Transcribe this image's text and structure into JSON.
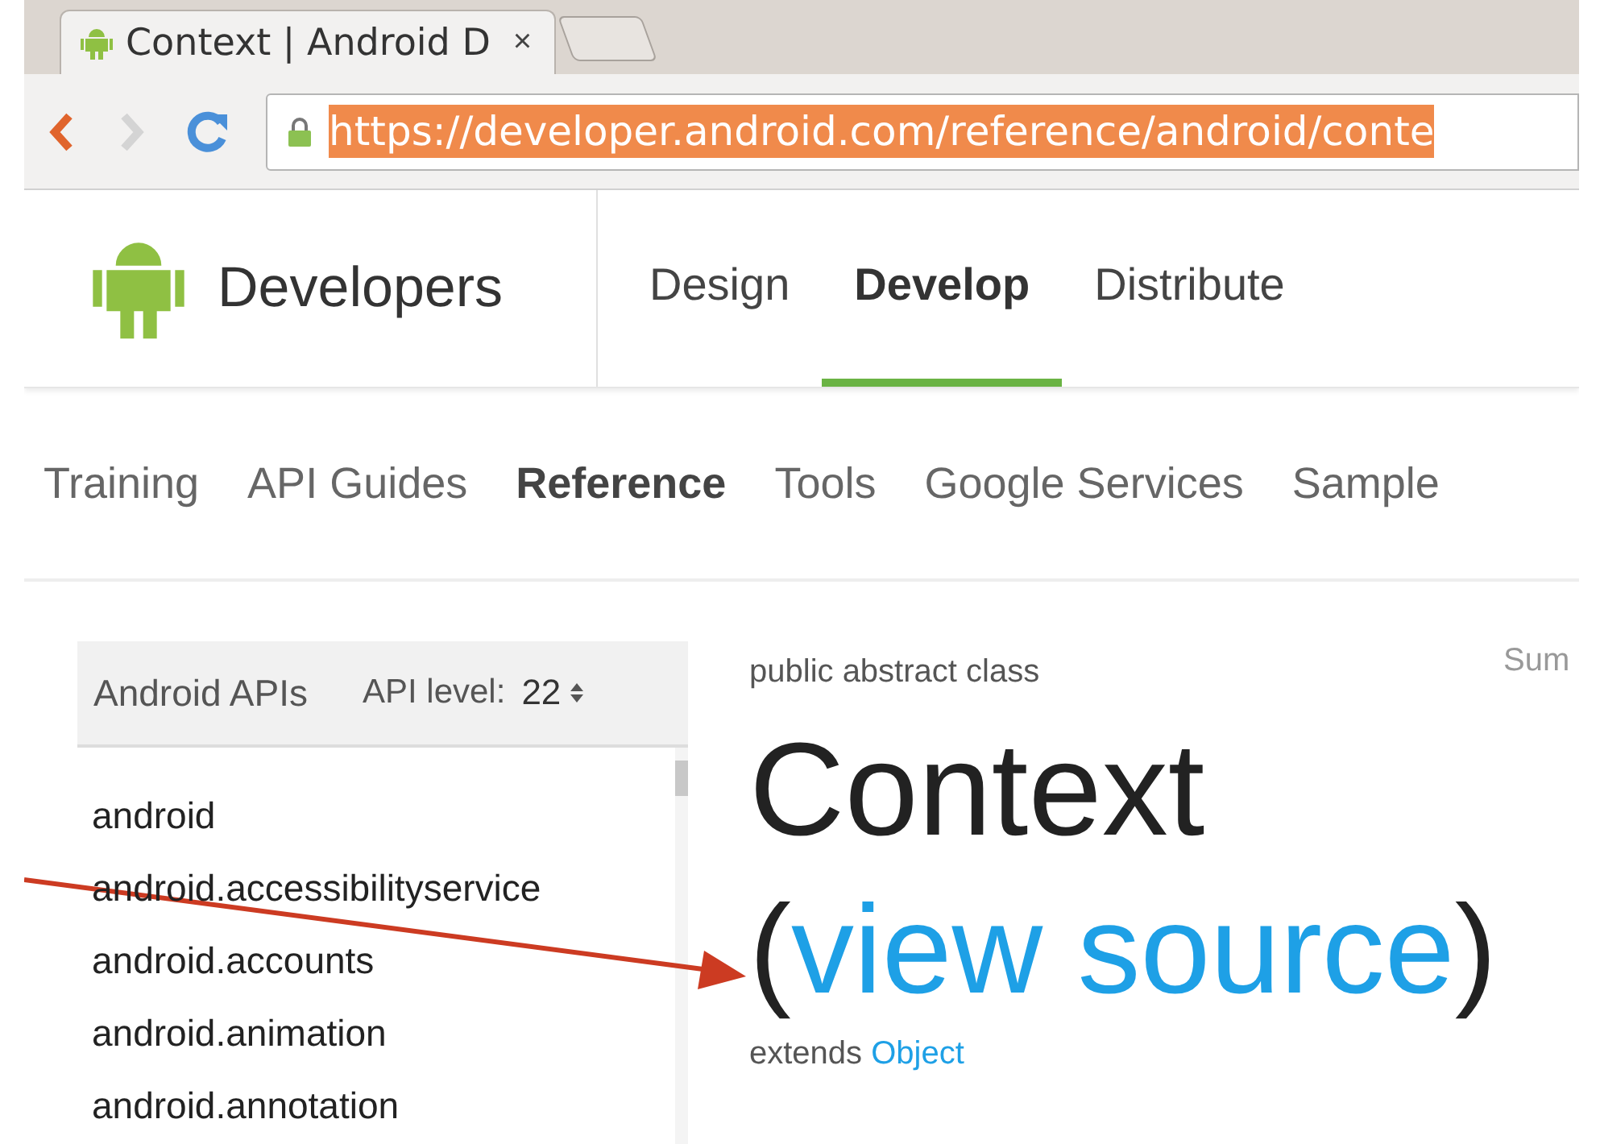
{
  "browser": {
    "tab": {
      "title": "Context | Android D",
      "close": "×"
    },
    "url": "https://developer.android.com/reference/android/conte",
    "url_selected": true
  },
  "site": {
    "brand": "Developers",
    "nav": [
      {
        "label": "Design",
        "selected": false
      },
      {
        "label": "Develop",
        "selected": true
      },
      {
        "label": "Distribute",
        "selected": false
      }
    ],
    "subnav": [
      {
        "label": "Training",
        "selected": false
      },
      {
        "label": "API Guides",
        "selected": false
      },
      {
        "label": "Reference",
        "selected": true
      },
      {
        "label": "Tools",
        "selected": false
      },
      {
        "label": "Google Services",
        "selected": false
      },
      {
        "label": "Sample",
        "selected": false
      }
    ]
  },
  "sidebar": {
    "title": "Android APIs",
    "api_level_label": "API level:",
    "api_level": "22",
    "packages": [
      "android",
      "android.accessibilityservice",
      "android.accounts",
      "android.animation",
      "android.annotation"
    ]
  },
  "content": {
    "modifiers": "public abstract class",
    "class_name": "Context",
    "source_open": "(",
    "source_link": "view source",
    "source_close": ")",
    "extends_label": "extends",
    "superclass": "Object",
    "summary_link": "Sum"
  }
}
